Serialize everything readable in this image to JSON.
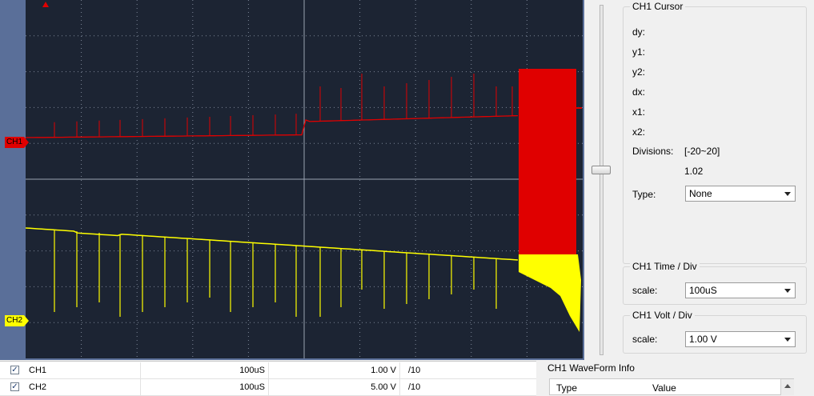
{
  "scope": {
    "ch1_marker": "CH1",
    "ch2_marker": "CH2",
    "ch1_color": "#e00000",
    "ch2_color": "#ffff00",
    "background": "#1c2433"
  },
  "cursor_panel": {
    "title": "CH1 Cursor",
    "dy_label": "dy:",
    "y1_label": "y1:",
    "y2_label": "y2:",
    "dx_label": "dx:",
    "x1_label": "x1:",
    "x2_label": "x2:",
    "divisions_label": "Divisions:",
    "divisions_range": "[-20~20]",
    "divisions_value": "1.02",
    "type_label": "Type:",
    "type_value": "None"
  },
  "time_panel": {
    "title": "CH1 Time / Div",
    "scale_label": "scale:",
    "scale_value": "100uS"
  },
  "volt_panel": {
    "title": "CH1 Volt / Div",
    "scale_label": "scale:",
    "scale_value": "1.00 V"
  },
  "channels": [
    {
      "checked": "✓",
      "name": "CH1",
      "time": "100uS",
      "volt": "1.00 V",
      "probe": "/10"
    },
    {
      "checked": "✓",
      "name": "CH2",
      "time": "100uS",
      "volt": "5.00 V",
      "probe": "/10"
    }
  ],
  "waveform_info": {
    "title": "CH1 WaveForm Info",
    "col_type": "Type",
    "col_value": "Value"
  }
}
